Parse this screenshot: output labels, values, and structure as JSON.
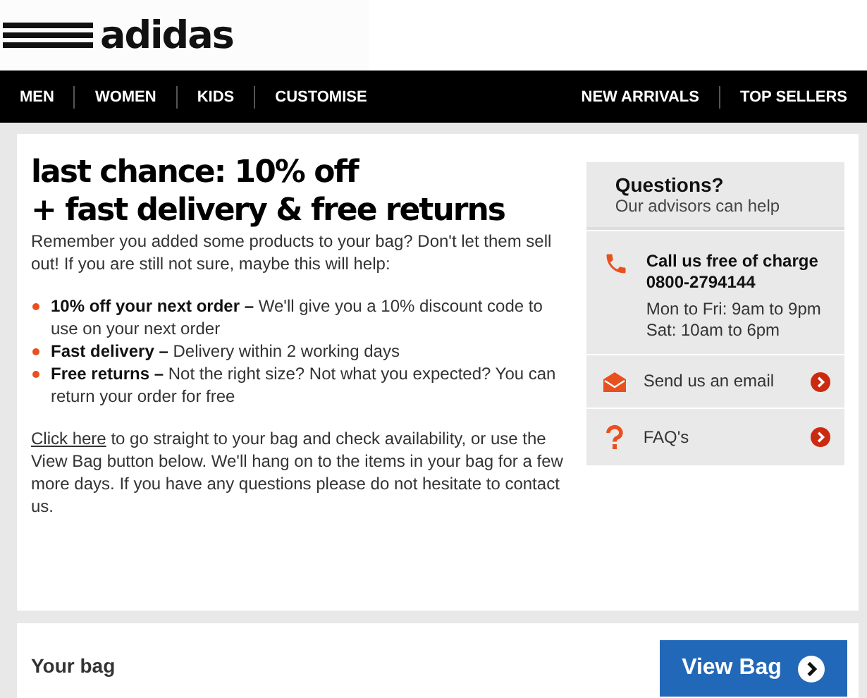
{
  "logo": {
    "wordmark": "adidas"
  },
  "nav": {
    "left": [
      "MEN",
      "WOMEN",
      "KIDS",
      "CUSTOMISE"
    ],
    "right": [
      "NEW ARRIVALS",
      "TOP SELLERS"
    ]
  },
  "headline": [
    "last chance: 10% off",
    "+ fast delivery & free returns"
  ],
  "intro": "Remember you added some products to your bag? Don't let them sell out! If you are still not sure, maybe this will help:",
  "benefits": [
    {
      "text": "**10% off your next order –** We'll give you a 10% discount code to use on your next order"
    },
    {
      "text": "**Fast delivery –** Delivery within 2 working days"
    },
    {
      "text": "**Free returns –** Not the right size? Not what you expected? You can return your order for free"
    }
  ],
  "closing": {
    "link": "Click here",
    "text": "to go straight to your bag and check availability, or use the View Bag button below. We'll hang on to the items in your bag for a few more days. If you have any questions please do not hesitate to contact us."
  },
  "help": {
    "title": "Questions?",
    "subtitle": "Our advisors can help",
    "items": [
      {
        "kind": "phone",
        "title": "Call us free of charge",
        "number": "0800-2794144",
        "hours": [
          "Mon to Fri: 9am to 9pm",
          "Sat: 10am to 6pm"
        ]
      },
      {
        "kind": "email",
        "label": "Send us an email"
      },
      {
        "kind": "faq",
        "label": "FAQ's"
      }
    ]
  },
  "bag": {
    "title": "Your bag",
    "button": "View Bag"
  }
}
